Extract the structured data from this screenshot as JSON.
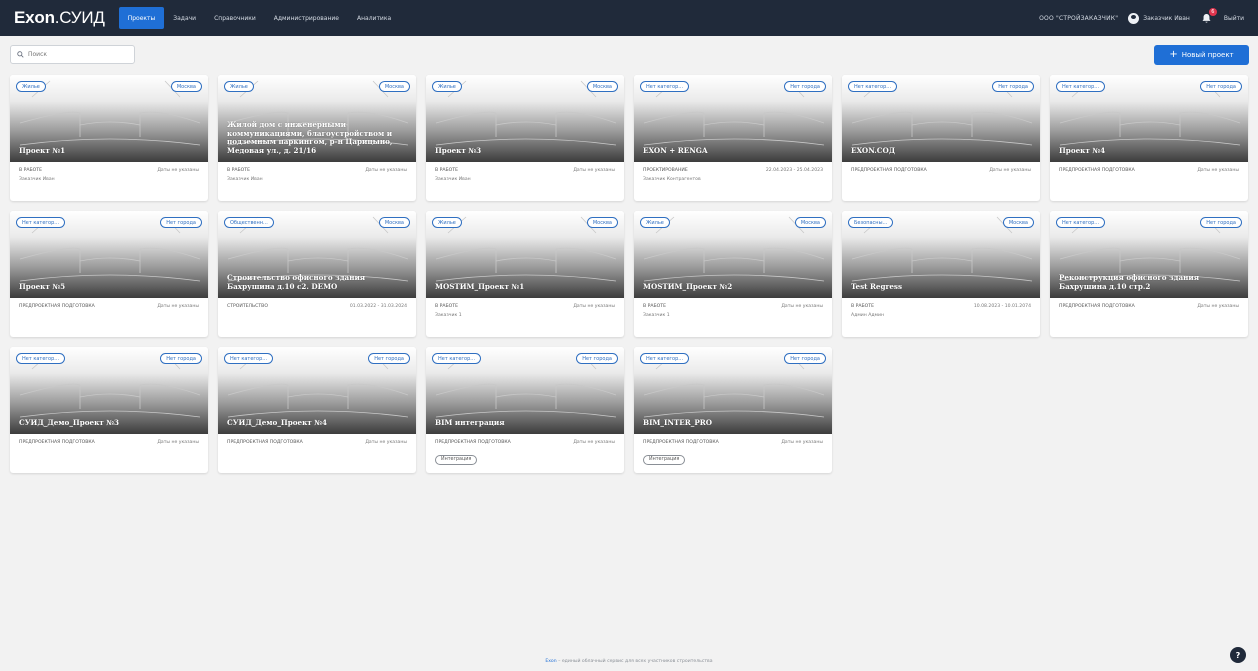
{
  "header": {
    "logo_main": "Exon",
    "logo_sub": ".СУИД",
    "nav": [
      {
        "label": "Проекты",
        "active": true
      },
      {
        "label": "Задачи",
        "active": false
      },
      {
        "label": "Справочники",
        "active": false
      },
      {
        "label": "Администрирование",
        "active": false
      },
      {
        "label": "Аналитика",
        "active": false
      }
    ],
    "org": "ООО \"СТРОЙЗАКАЗЧИК\"",
    "user": "Заказчик Иван",
    "notifications": "6",
    "logout": "Выйти"
  },
  "search": {
    "placeholder": "Поиск"
  },
  "new_project": {
    "label": "Новый проект"
  },
  "projects": [
    {
      "tag_left": "Жилье",
      "tag_right": "Москва",
      "title": "Проект №1",
      "status": "В работе",
      "date": "Даты не указаны",
      "owner": "Заказчик Иван",
      "chip": ""
    },
    {
      "tag_left": "Жилье",
      "tag_right": "Москва",
      "title": "Жилой дом с инженерными коммуникациями, благоустройством и подземным паркингом, р-н Царицыно, Медовая ул., д. 21/16",
      "status": "В работе",
      "date": "Даты не указаны",
      "owner": "Заказчик Иван",
      "chip": ""
    },
    {
      "tag_left": "Жилье",
      "tag_right": "Москва",
      "title": "Проект №3",
      "status": "В работе",
      "date": "Даты не указаны",
      "owner": "Заказчик Иван",
      "chip": ""
    },
    {
      "tag_left": "Нет категор...",
      "tag_right": "Нет города",
      "title": "EXON + RENGA",
      "status": "Проектирование",
      "date": "22.04.2023 - 25.04.2023",
      "owner": "Заказчик Контрагентов",
      "chip": ""
    },
    {
      "tag_left": "Нет категор...",
      "tag_right": "Нет города",
      "title": "EXON.СОД",
      "status": "Предпроектная подготовка",
      "date": "Даты не указаны",
      "owner": "",
      "chip": ""
    },
    {
      "tag_left": "Нет категор...",
      "tag_right": "Нет города",
      "title": "Проект №4",
      "status": "Предпроектная подготовка",
      "date": "Даты не указаны",
      "owner": "",
      "chip": ""
    },
    {
      "tag_left": "Нет категор...",
      "tag_right": "Нет города",
      "title": "Проект №5",
      "status": "Предпроектная подготовка",
      "date": "Даты не указаны",
      "owner": "",
      "chip": ""
    },
    {
      "tag_left": "Общественн...",
      "tag_right": "Москва",
      "title": "Строительство офисного здания Бахрушина д.10 с2. DEMO",
      "status": "Строительство",
      "date": "01.03.2022 - 31.03.2024",
      "owner": "",
      "chip": ""
    },
    {
      "tag_left": "Жилье",
      "tag_right": "Москва",
      "title": "MOSTИМ_Проект №1",
      "status": "В работе",
      "date": "Даты не указаны",
      "owner": "Заказчик 1",
      "chip": ""
    },
    {
      "tag_left": "Жилье",
      "tag_right": "Москва",
      "title": "MOSTИМ_Проект №2",
      "status": "В работе",
      "date": "Даты не указаны",
      "owner": "Заказчик 1",
      "chip": ""
    },
    {
      "tag_left": "Безопасны...",
      "tag_right": "Москва",
      "title": "Test Regress",
      "status": "В работе",
      "date": "10.08.2023 - 10.01.2074",
      "owner": "Админ Админ",
      "chip": ""
    },
    {
      "tag_left": "Нет категор...",
      "tag_right": "Нет города",
      "title": "Реконструкция офисного здания Бахрушина д.10 стр.2",
      "status": "Предпроектная подготовка",
      "date": "Даты не указаны",
      "owner": "",
      "chip": ""
    },
    {
      "tag_left": "Нет категор...",
      "tag_right": "Нет города",
      "title": "СУИД_Демо_Проект №3",
      "status": "Предпроектная подготовка",
      "date": "Даты не указаны",
      "owner": "",
      "chip": ""
    },
    {
      "tag_left": "Нет категор...",
      "tag_right": "Нет города",
      "title": "СУИД_Демо_Проект №4",
      "status": "Предпроектная подготовка",
      "date": "Даты не указаны",
      "owner": "",
      "chip": ""
    },
    {
      "tag_left": "Нет категор...",
      "tag_right": "Нет города",
      "title": "BIM интеграция",
      "status": "Предпроектная подготовка",
      "date": "Даты не указаны",
      "owner": "",
      "chip": "Интеграция"
    },
    {
      "tag_left": "Нет категор...",
      "tag_right": "Нет города",
      "title": "BIM_INTER_PRO",
      "status": "Предпроектная подготовка",
      "date": "Даты не указаны",
      "owner": "",
      "chip": "Интеграция"
    }
  ],
  "footer": {
    "brand": "Exon",
    "text": " – единый облачный сервис для всех участников строительства"
  },
  "help": "?",
  "colors": {
    "topbar": "#202a3a",
    "accent": "#1f6fd6",
    "tag": "#2f6fc1",
    "badge": "#e0344d"
  },
  "icons": {
    "search": "search-icon",
    "user": "user-icon",
    "bell": "bell-icon",
    "help": "help-icon",
    "plus": "plus-icon"
  }
}
